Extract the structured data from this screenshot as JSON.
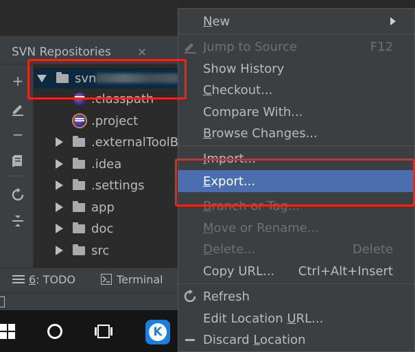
{
  "panel": {
    "title": "SVN Repositories",
    "close": "×"
  },
  "toolbar": {
    "add": "+",
    "minus": "−"
  },
  "tree": {
    "root_label": "svn",
    "items": [
      {
        "label": ".classpath",
        "kind": "file-eclipse"
      },
      {
        "label": ".project",
        "kind": "file-eclipse"
      },
      {
        "label": ".externalToolBu",
        "kind": "folder"
      },
      {
        "label": ".idea",
        "kind": "folder"
      },
      {
        "label": ".settings",
        "kind": "folder"
      },
      {
        "label": "app",
        "kind": "folder"
      },
      {
        "label": "doc",
        "kind": "folder"
      },
      {
        "label": "src",
        "kind": "folder"
      }
    ]
  },
  "bottombar": {
    "todo_num": "6",
    "todo_label": ": TODO",
    "terminal_label": "Terminal"
  },
  "menu": {
    "new": {
      "u": "N",
      "rest": "ew"
    },
    "jump_to_source": "Jump to Source",
    "jump_shortcut": "F12",
    "show_history": "Show History",
    "checkout": {
      "u": "C",
      "rest": "heckout..."
    },
    "compare_with": "Compare With...",
    "browse_changes": {
      "u": "B",
      "rest": "rowse Changes..."
    },
    "import": {
      "u": "I",
      "rest": "mport..."
    },
    "export": {
      "u": "E",
      "rest": "xport..."
    },
    "branch_or_tag": {
      "u": "B",
      "rest": "ranch or Tag..."
    },
    "move_or_rename": {
      "u": "M",
      "rest": "ove or Rename..."
    },
    "delete": {
      "u": "D",
      "rest": "elete..."
    },
    "delete_shortcut": "Delete",
    "copy_url": "Copy URL...",
    "copy_url_shortcut": "Ctrl+Alt+Insert",
    "refresh": "Refresh",
    "edit_location_url": {
      "pre": "Edit Location ",
      "u": "U",
      "rest": "RL..."
    },
    "discard_location": {
      "pre": "Discard ",
      "u": "L",
      "rest": "ocation"
    }
  },
  "colors": {
    "highlight": "#4b6eaf",
    "annotation_red": "#e8271f"
  }
}
